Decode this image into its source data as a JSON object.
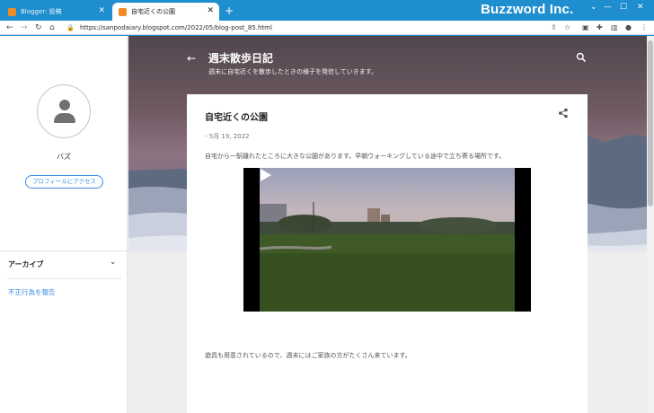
{
  "browser": {
    "tabs": [
      {
        "label": "Blogger: 投稿"
      },
      {
        "label": "自宅近くの公園"
      }
    ],
    "brand": "Buzzword Inc.",
    "url": "https://sanpodaiary.blogspot.com/2022/05/blog-post_85.html"
  },
  "sidebar": {
    "profile_name": "バズ",
    "profile_button": "プロフィールにアクセス",
    "archive_label": "アーカイブ",
    "report_link": "不正行為を報告"
  },
  "blog": {
    "title": "週末散歩日記",
    "description": "週末に自宅近くを散歩したときの様子を発信していきます。"
  },
  "post": {
    "title": "自宅近くの公園",
    "date": "- 5月 19, 2022",
    "paragraph1": "自宅から一駅離れたところに大きな公園があります。早朝ウォーキングしている途中で立ち寄る場所です。",
    "paragraph2": "遊具も用意されているので、週末にはご家族の方がたくさん来ています。"
  },
  "colors": {
    "browser_chrome": "#1f8ecf",
    "link": "#3b8ede",
    "favicon": "#f08a24"
  }
}
